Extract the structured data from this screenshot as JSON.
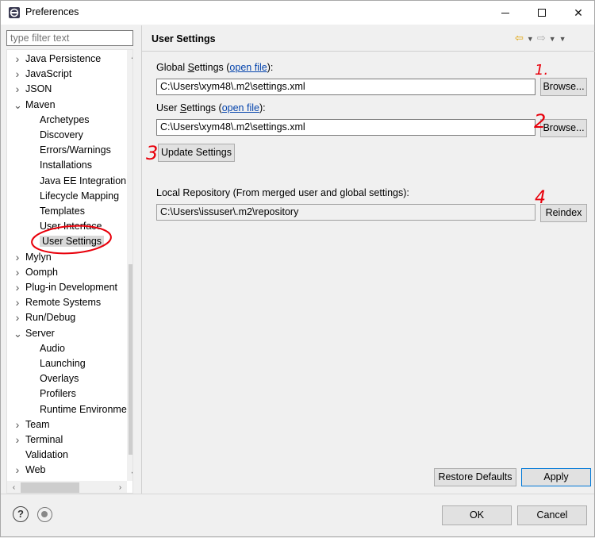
{
  "window": {
    "title": "Preferences",
    "minimize": "minimize",
    "maximize": "maximize",
    "close": "✕"
  },
  "filter": {
    "placeholder": "type filter text"
  },
  "tree": {
    "items": [
      {
        "label": "Java Persistence",
        "level": 0,
        "expander": "collapsed"
      },
      {
        "label": "JavaScript",
        "level": 0,
        "expander": "collapsed"
      },
      {
        "label": "JSON",
        "level": 0,
        "expander": "collapsed"
      },
      {
        "label": "Maven",
        "level": 0,
        "expander": "expanded"
      },
      {
        "label": "Archetypes",
        "level": 1,
        "expander": "none"
      },
      {
        "label": "Discovery",
        "level": 1,
        "expander": "none"
      },
      {
        "label": "Errors/Warnings",
        "level": 1,
        "expander": "none"
      },
      {
        "label": "Installations",
        "level": 1,
        "expander": "none"
      },
      {
        "label": "Java EE Integration",
        "level": 1,
        "expander": "none"
      },
      {
        "label": "Lifecycle Mapping",
        "level": 1,
        "expander": "none"
      },
      {
        "label": "Templates",
        "level": 1,
        "expander": "none"
      },
      {
        "label": "User Interface",
        "level": 1,
        "expander": "none"
      },
      {
        "label": "User Settings",
        "level": 1,
        "expander": "none",
        "selected": true
      },
      {
        "label": "Mylyn",
        "level": 0,
        "expander": "collapsed"
      },
      {
        "label": "Oomph",
        "level": 0,
        "expander": "collapsed"
      },
      {
        "label": "Plug-in Development",
        "level": 0,
        "expander": "collapsed"
      },
      {
        "label": "Remote Systems",
        "level": 0,
        "expander": "collapsed"
      },
      {
        "label": "Run/Debug",
        "level": 0,
        "expander": "collapsed"
      },
      {
        "label": "Server",
        "level": 0,
        "expander": "expanded"
      },
      {
        "label": "Audio",
        "level": 1,
        "expander": "none"
      },
      {
        "label": "Launching",
        "level": 1,
        "expander": "none"
      },
      {
        "label": "Overlays",
        "level": 1,
        "expander": "none"
      },
      {
        "label": "Profilers",
        "level": 1,
        "expander": "none"
      },
      {
        "label": "Runtime Environments",
        "level": 1,
        "expander": "none"
      },
      {
        "label": "Team",
        "level": 0,
        "expander": "collapsed"
      },
      {
        "label": "Terminal",
        "level": 0,
        "expander": "collapsed"
      },
      {
        "label": "Validation",
        "level": 0,
        "expander": "none"
      },
      {
        "label": "Web",
        "level": 0,
        "expander": "collapsed"
      }
    ]
  },
  "page": {
    "title": "User Settings",
    "global": {
      "label_prefix": "Global ",
      "label_mnemonic": "S",
      "label_rest": "ettings (",
      "link": "open file",
      "label_end": "):",
      "value": "C:\\Users\\xym48\\.m2\\settings.xml",
      "browse": "Browse..."
    },
    "user": {
      "label_prefix": "User ",
      "label_mnemonic": "S",
      "label_rest": "ettings (",
      "link": "open file",
      "label_end": "):",
      "value": "C:\\Users\\xym48\\.m2\\settings.xml",
      "browse": "Browse..."
    },
    "update_button": "Update Settings",
    "local_repo": {
      "label": "Local Repository (From merged user and global settings):",
      "value": "C:\\Users\\issuser\\.m2\\repository",
      "reindex": "Reindex"
    },
    "restore_defaults": "Restore Defaults",
    "apply": "Apply"
  },
  "footer": {
    "ok": "OK",
    "cancel": "Cancel"
  },
  "annotations": {
    "color": "#e8000b",
    "numbers": [
      "1.",
      "2",
      "3",
      "4"
    ]
  },
  "colors": {
    "link": "#0645ad",
    "accent": "#0078d7"
  }
}
